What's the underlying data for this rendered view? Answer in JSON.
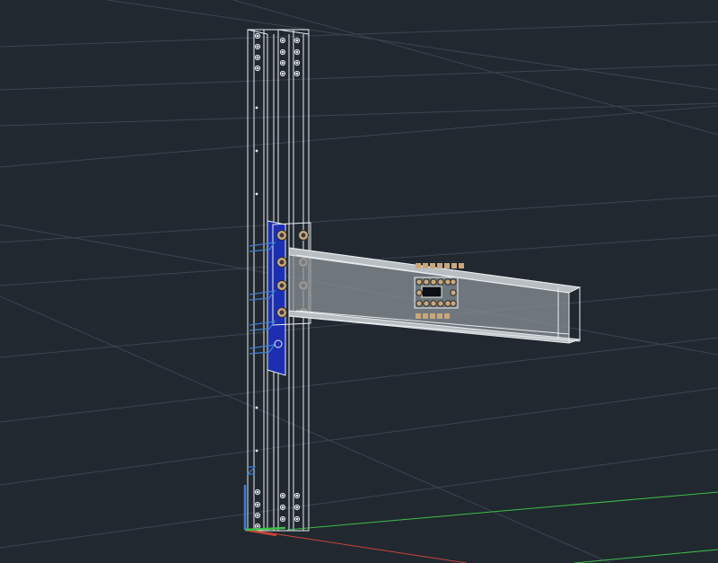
{
  "viewport": {
    "background": "#212830",
    "grid_color": "#3a4552",
    "wire_color": "#e8ecf0",
    "beam_fill": "#8a9197",
    "plate_color": "#1d2fb0",
    "stiffener_color": "#3f7fd0",
    "bolt_color": "#c9a77b",
    "axis_x_color": "#c8453a",
    "axis_y_color": "#3fbf4a",
    "axis_z_color": "#3a7fd6"
  },
  "model": {
    "column_name": "steel-column",
    "beam_name": "steel-beam",
    "connection_name": "end-plate-connection",
    "splice_name": "beam-web-splice"
  },
  "icons": {
    "ucs": "ucs-axes-icon"
  }
}
